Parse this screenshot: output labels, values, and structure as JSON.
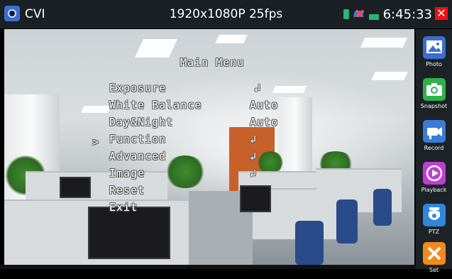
{
  "topbar": {
    "app_name": "CVI",
    "resolution": "1920x1080P 25fps",
    "time": "6:45:33",
    "close_symbol": "✕",
    "status_icons": [
      "sim-card-icon",
      "no-network-icon",
      "battery-icon"
    ]
  },
  "osd_menu": {
    "title": "Main Menu",
    "selected_marker": ">",
    "items": [
      {
        "label": "Exposure",
        "value": "↲"
      },
      {
        "label": "White Balance",
        "value": "Auto"
      },
      {
        "label": "Day&Night",
        "value": "Auto"
      },
      {
        "label": "Function",
        "value": "↲"
      },
      {
        "label": "Advanced",
        "value": "↲"
      },
      {
        "label": "Image",
        "value": "↲"
      },
      {
        "label": "Reset",
        "value": ""
      },
      {
        "label": "Exit",
        "value": ""
      }
    ]
  },
  "sidebar": {
    "items": [
      {
        "label": "Photo",
        "icon": "photo-icon",
        "color": "#3a6fd1"
      },
      {
        "label": "Snapshot",
        "icon": "camera-icon",
        "color": "#2fb24a"
      },
      {
        "label": "Record",
        "icon": "video-camera-icon",
        "color": "#3a7bd5"
      },
      {
        "label": "Playback",
        "icon": "play-icon",
        "color": "#c03dd4"
      },
      {
        "label": "PTZ",
        "icon": "dome-camera-icon",
        "color": "#2e86de"
      },
      {
        "label": "Set",
        "icon": "tools-icon",
        "color": "#f08a1c"
      }
    ]
  },
  "colors": {
    "topbar_bg": "#1b2025",
    "sidebar_bg": "#1d2226",
    "close_red": "#e11111"
  }
}
